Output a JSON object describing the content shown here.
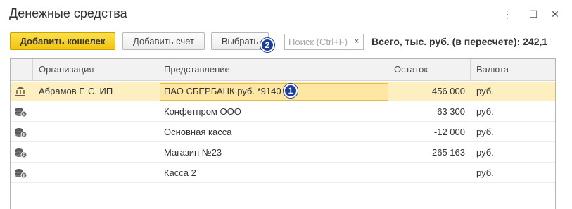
{
  "window": {
    "title": "Денежные средства",
    "controls": {
      "more": "⋮",
      "maximize": "☐",
      "close": "✕"
    }
  },
  "toolbar": {
    "add_wallet_label": "Добавить кошелек",
    "add_account_label": "Добавить счет",
    "select_label": "Выбрать",
    "search_placeholder": "Поиск (Ctrl+F)",
    "search_clear": "×",
    "total_label": "Всего, тыс. руб. (в пересчете): 242,1"
  },
  "badges": {
    "one": "1",
    "two": "2"
  },
  "table": {
    "columns": [
      "Организация",
      "Представление",
      "Остаток",
      "Валюта"
    ],
    "rows": [
      {
        "icon": "bank-icon",
        "organization": "Абрамов Г. С. ИП",
        "representation": "ПАО СБЕРБАНК руб. *9140",
        "balance": "456 000",
        "currency": "руб.",
        "selected": true
      },
      {
        "icon": "coins-icon",
        "organization": "",
        "representation": "Конфетпром ООО",
        "balance": "63 300",
        "currency": "руб.",
        "selected": false
      },
      {
        "icon": "coins-icon",
        "organization": "",
        "representation": "Основная касса",
        "balance": "-12 000",
        "currency": "руб.",
        "selected": false
      },
      {
        "icon": "coins-icon",
        "organization": "",
        "representation": "Магазин №23",
        "balance": "-265 163",
        "currency": "руб.",
        "selected": false
      },
      {
        "icon": "coins-icon",
        "organization": "",
        "representation": "Касса 2",
        "balance": "",
        "currency": "руб.",
        "selected": false
      }
    ]
  },
  "colors": {
    "accent": "#f1c40f",
    "selection": "#fdefbf",
    "badge": "#1e3d98"
  }
}
